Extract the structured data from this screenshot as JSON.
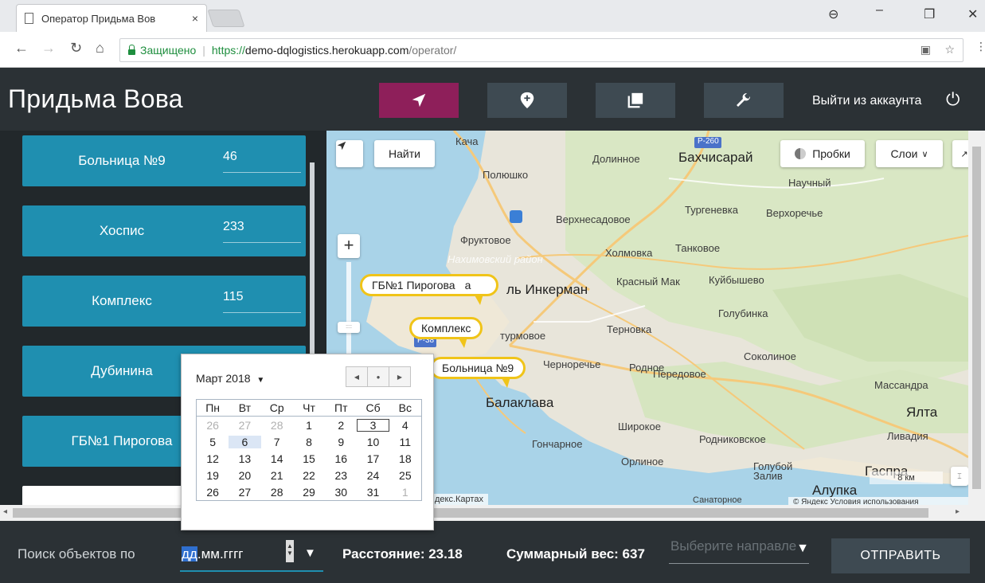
{
  "browser": {
    "tab_title": "Оператор Придьма Вов",
    "tab_close": "×",
    "secure_label": "Защищено",
    "url_scheme": "https://",
    "url_host": "demo-dqlogistics.herokuapp.com",
    "url_path": "/operator/",
    "icons": [
      "back-icon",
      "forward-icon",
      "reload-icon",
      "home-icon",
      "lock-icon",
      "translate-icon",
      "star-icon",
      "menu-icon",
      "profile-icon",
      "minimize-icon",
      "restore-icon",
      "close-icon"
    ]
  },
  "header": {
    "brand": "Придьма Вова",
    "nav": [
      {
        "icon": "navigation-arrow-icon",
        "active": true
      },
      {
        "icon": "map-pin-icon",
        "active": false
      },
      {
        "icon": "collection-icon",
        "active": false
      },
      {
        "icon": "wrench-icon",
        "active": false
      }
    ],
    "logout_label": "Выйти из аккаунта",
    "accent": "#8e1f5a"
  },
  "objects": [
    {
      "name": "Больница №9",
      "value": "46"
    },
    {
      "name": "Хоспис",
      "value": "233"
    },
    {
      "name": "Комплекс",
      "value": "115"
    },
    {
      "name": "Дубинина",
      "value": ""
    },
    {
      "name": "ГБ№1 Пирогова",
      "value": ""
    }
  ],
  "map": {
    "find_label": "Найти",
    "traffic_label": "Пробки",
    "layers_label": "Слои",
    "zoom_in": "+",
    "scale_label": "8 км",
    "copyright": "декс.Картах",
    "copyright_right": "© Яндекс Условия использования",
    "road_label": "Р-260",
    "road_label_2": "Р-38",
    "places": {
      "kacha": "Кача",
      "dolinnoe": "Долинное",
      "bakhchisaray": "Бахчисарай",
      "nauchny": "Научный",
      "polyushko": "Полюшко",
      "turgenevka": "Тургеневка",
      "verkhorechye": "Верхоречье",
      "verkhnesadovoe": "Верхнесадовое",
      "fruktovoe": "Фруктовое",
      "tankovoe": "Танковое",
      "kholmovka": "Холмовка",
      "nakhimovsky": "Нахимовский район",
      "kuibyshevo": "Куйбышево",
      "krasny_mak": "Красный Мак",
      "inkerman": "ль Инкерман",
      "golubinka": "Голубинка",
      "ternovka": "Терновка",
      "sturmovoe": "турмовое",
      "sokolinoe": "Соколиное",
      "chernorechye": "Черноречье",
      "rodnoe": "Родное",
      "massandra": "Массандра",
      "peredovoe": "Передовое",
      "balaklava": "Балаклава",
      "yalta": "Ялта",
      "shirokoe": "Широкое",
      "rodnikovskoe": "Родниковское",
      "livadiya": "Ливадия",
      "goncharnoe": "Гончарное",
      "orlinoe": "Орлиное",
      "golubnoy_zaliv": "Голубой Залив",
      "gaspra": "Гаспра",
      "alupka": "Алупка",
      "sanatornoe": "Санаторное"
    },
    "markers": [
      {
        "label": "ГБ№1 Пирогова",
        "tail": "а"
      },
      {
        "label": "Комплекс"
      },
      {
        "label": "Больница №9"
      }
    ]
  },
  "calendar": {
    "month_label": "Март 2018",
    "weekdays": [
      "Пн",
      "Вт",
      "Ср",
      "Чт",
      "Пт",
      "Сб",
      "Вс"
    ],
    "weeks": [
      [
        "26",
        "27",
        "28",
        "1",
        "2",
        "3",
        "4"
      ],
      [
        "5",
        "6",
        "7",
        "8",
        "9",
        "10",
        "11"
      ],
      [
        "12",
        "13",
        "14",
        "15",
        "16",
        "17",
        "18"
      ],
      [
        "19",
        "20",
        "21",
        "22",
        "23",
        "24",
        "25"
      ],
      [
        "26",
        "27",
        "28",
        "29",
        "30",
        "31",
        "1"
      ]
    ]
  },
  "bottom": {
    "search_label": "Поиск объектов по",
    "date_highlight": "дд",
    "date_rest": ".мм.гггг",
    "distance_label": "Расстояние: 23.18",
    "weight_label": "Суммарный вес: 637",
    "direction_placeholder": "Выберите направле",
    "send_label": "ОТПРАВИТЬ"
  }
}
